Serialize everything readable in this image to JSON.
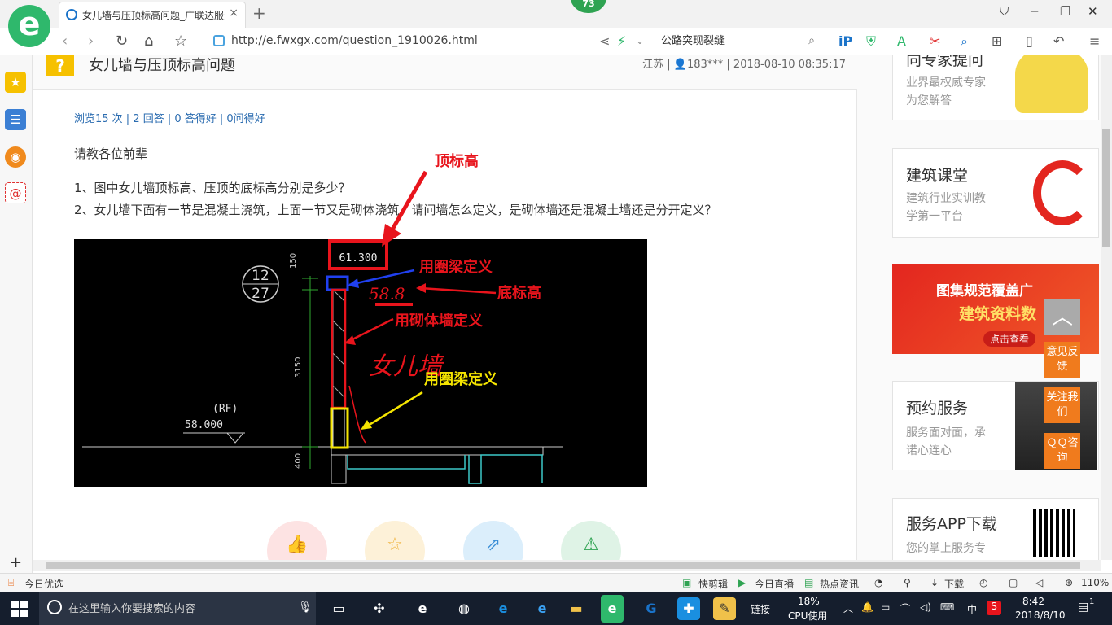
{
  "browser": {
    "tab_title": "女儿墙与压顶标高问题_广联达服务新干线",
    "tab_close": "×",
    "new_tab": "+",
    "notification_count": "73",
    "url": "http://e.fwxgx.com/question_1910026.html",
    "search_placeholder": "公路突现裂缝",
    "window_buttons": {
      "minimize": "─",
      "maximize": "❐",
      "close": "✕",
      "skin": "⛉"
    }
  },
  "page": {
    "question_title": "女儿墙与压顶标高问题",
    "meta": "江苏 | 👤183*** | 2018-08-10 08:35:17",
    "stats": "浏览15 次 | 2 回答 | 0 答得好 | 0问得好",
    "greeting": "请教各位前辈",
    "question_1": "1、图中女儿墙顶标高、压顶的底标高分别是多少？",
    "question_2": "2、女儿墙下面有一节是混凝土浇筑，上面一节又是砌体浇筑，请问墙怎么定义，是砌体墙还是混凝土墙还是分开定义？"
  },
  "drawing": {
    "anno_top": "顶标高",
    "anno_ring_beam_1": "用圈梁定义",
    "anno_bottom": "底标高",
    "anno_masonry": "用砌体墙定义",
    "anno_ring_beam_2": "用圈梁定义",
    "handwritten_elev": "58.8",
    "handwritten_wall": "女儿墙",
    "elev_top": "61.300",
    "elev_roof_tag": "(RF)",
    "elev_roof": "58.000",
    "detail_top": "12",
    "detail_bottom": "27",
    "dim_150": "150",
    "dim_3150": "3150",
    "dim_400": "400"
  },
  "sidebar": {
    "card_expert": {
      "title": "向专家提问",
      "sub1": "业界最权威专家",
      "sub2": "为您解答"
    },
    "card_class": {
      "title": "建筑课堂",
      "sub1": "建筑行业实训教",
      "sub2": "学第一平台"
    },
    "banner": {
      "line1": "图集规范覆盖广",
      "line2": "建筑资料数",
      "button": "点击查看"
    },
    "card_service": {
      "title": "预约服务",
      "sub1": "服务面对面，承",
      "sub2": "诺心连心"
    },
    "card_app": {
      "title": "服务APP下载",
      "sub1": "您的掌上服务专"
    },
    "float_feedback": "意见反馈",
    "float_follow": "关注我们",
    "float_qq": "ＱＱ咨询",
    "float_top": "︿"
  },
  "statusbar": {
    "left": "今日优选",
    "kuaijianji": "快剪辑",
    "live": "今日直播",
    "news": "热点资讯",
    "download": "下载",
    "zoom": "110%"
  },
  "taskbar": {
    "search_placeholder": "在这里输入你要搜索的内容",
    "link": "链接",
    "cpu_percent": "18%",
    "cpu_label": "CPU使用",
    "ime": "中",
    "time": "8:42",
    "date": "2018/8/10",
    "notifications": "1"
  },
  "colors": {
    "accent_green": "#2fb86c",
    "link_blue": "#2b6cb0",
    "annotation_red": "#e8141c",
    "annotation_yellow": "#f5e500",
    "float_orange": "#f07b1d"
  }
}
